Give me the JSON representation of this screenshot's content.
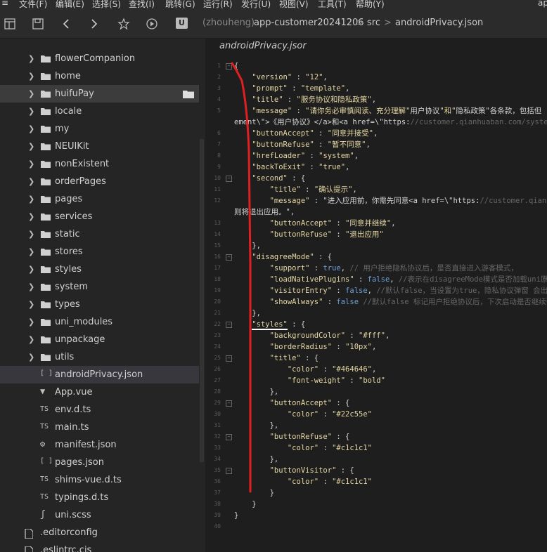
{
  "menu": {
    "items": [
      "文件(F)",
      "编辑(E)",
      "选择(S)",
      "查找(I)",
      "跳转(G)",
      "运行(R)",
      "发行(U)",
      "视图(V)",
      "工具(T)",
      "帮助(Y)"
    ],
    "tail": "ap"
  },
  "toolbar": {
    "badge": "U",
    "crumbs": [
      "(zhouheng)",
      "app-customer20241206",
      ">",
      "src",
      ">",
      "androidPrivacy.json"
    ]
  },
  "sidebar": {
    "folders": [
      "flowerCompanion",
      "home",
      "huifuPay",
      "locale",
      "my",
      "NEUIKit",
      "nonExistent",
      "orderPages",
      "pages",
      "services",
      "static",
      "stores",
      "styles",
      "system",
      "types",
      "uni_modules",
      "unpackage",
      "utils"
    ],
    "files": [
      {
        "type": "[ ]",
        "name": "androidPrivacy.json"
      },
      {
        "type": "vue",
        "name": "App.vue"
      },
      {
        "type": "TS",
        "name": "env.d.ts"
      },
      {
        "type": "TS",
        "name": "main.ts"
      },
      {
        "type": "gear",
        "name": "manifest.json"
      },
      {
        "type": "[ ]",
        "name": "pages.json"
      },
      {
        "type": "TS",
        "name": "shims-vue.d.ts"
      },
      {
        "type": "TS",
        "name": "typings.d.ts"
      },
      {
        "type": "s",
        "name": "uni.scss"
      }
    ],
    "root_files": [
      ".editorconfig",
      ".eslintrc.cjs"
    ]
  },
  "editor": {
    "tab_title": "androidPrivacy.jsor",
    "lines": [
      {
        "n": "1",
        "t": "{"
      },
      {
        "n": "2",
        "t": "    \"version\" : \"12\","
      },
      {
        "n": "3",
        "t": "    \"prompt\" : \"template\","
      },
      {
        "n": "4",
        "t": "    \"title\" : \"服务协议和隐私政策\","
      },
      {
        "n": "5",
        "t": "    \"message\" : \"请你务必审慎阅读、充分理解\"用户协议\"和\"隐私政策\"各条款，包括但"
      },
      {
        "n": "",
        "t": "ement\\\">《用户协议》</a>和<a href=\\\"https://customer.qianhuaban.com/system/p"
      },
      {
        "n": "6",
        "t": "    \"buttonAccept\" : \"同意并接受\","
      },
      {
        "n": "7",
        "t": "    \"buttonRefuse\" : \"暂不同意\","
      },
      {
        "n": "8",
        "t": "    \"hrefLoader\" : \"system\","
      },
      {
        "n": "9",
        "t": "    \"backToExit\" : \"true\","
      },
      {
        "n": "10",
        "t": "    \"second\" : {"
      },
      {
        "n": "11",
        "t": "        \"title\" : \"确认提示\","
      },
      {
        "n": "12",
        "t": "        \"message\" : \"进入应用前，你需先同意<a href=\\\"https://customer.qianhu"
      },
      {
        "n": "",
        "t": "则将退出应用。\","
      },
      {
        "n": "13",
        "t": "        \"buttonAccept\" : \"同意并继续\","
      },
      {
        "n": "14",
        "t": "        \"buttonRefuse\" : \"退出应用\""
      },
      {
        "n": "15",
        "t": "    },"
      },
      {
        "n": "16",
        "t": "    \"disagreeMode\" : {"
      },
      {
        "n": "17",
        "t": "        \"support\" : true, // 用户拒绝隐私协议后，是否直接进入游客模式，"
      },
      {
        "n": "18",
        "t": "        \"loadNativePlugins\" : false, //表示在disagreeMode模式是否加载uni原生"
      },
      {
        "n": "19",
        "t": "        \"visitorEntry\" : false, //默认false，当设置为true，隐私协议弹窗 会出现"
      },
      {
        "n": "20",
        "t": "        \"showAlways\" : false //默认false 标记用户拒绝协议后，下次启动是否继续弹"
      },
      {
        "n": "21",
        "t": "    },"
      },
      {
        "n": "22",
        "t": "    \"styles\" : {"
      },
      {
        "n": "23",
        "t": "        \"backgroundColor\" : \"#fff\","
      },
      {
        "n": "24",
        "t": "        \"borderRadius\" : \"10px\","
      },
      {
        "n": "25",
        "t": "        \"title\" : {"
      },
      {
        "n": "26",
        "t": "            \"color\" : \"#464646\","
      },
      {
        "n": "27",
        "t": "            \"font-weight\" : \"bold\""
      },
      {
        "n": "28",
        "t": "        },"
      },
      {
        "n": "29",
        "t": "        \"buttonAccept\" : {"
      },
      {
        "n": "30",
        "t": "            \"color\" : \"#22c55e\""
      },
      {
        "n": "31",
        "t": "        },"
      },
      {
        "n": "32",
        "t": "        \"buttonRefuse\" : {"
      },
      {
        "n": "33",
        "t": "            \"color\" : \"#c1c1c1\""
      },
      {
        "n": "34",
        "t": "        },"
      },
      {
        "n": "35",
        "t": "        \"buttonVisitor\" : {"
      },
      {
        "n": "36",
        "t": "            \"color\" : \"#c1c1c1\""
      },
      {
        "n": "37",
        "t": "        }"
      },
      {
        "n": "38",
        "t": "    }"
      },
      {
        "n": "39",
        "t": "}"
      },
      {
        "n": "40",
        "t": ""
      }
    ]
  },
  "colors": {
    "accent_red": "#e02020",
    "underline_white": "#ffffff",
    "underline_green": "#22c55e",
    "underline_gray": "#c1c1c1"
  }
}
